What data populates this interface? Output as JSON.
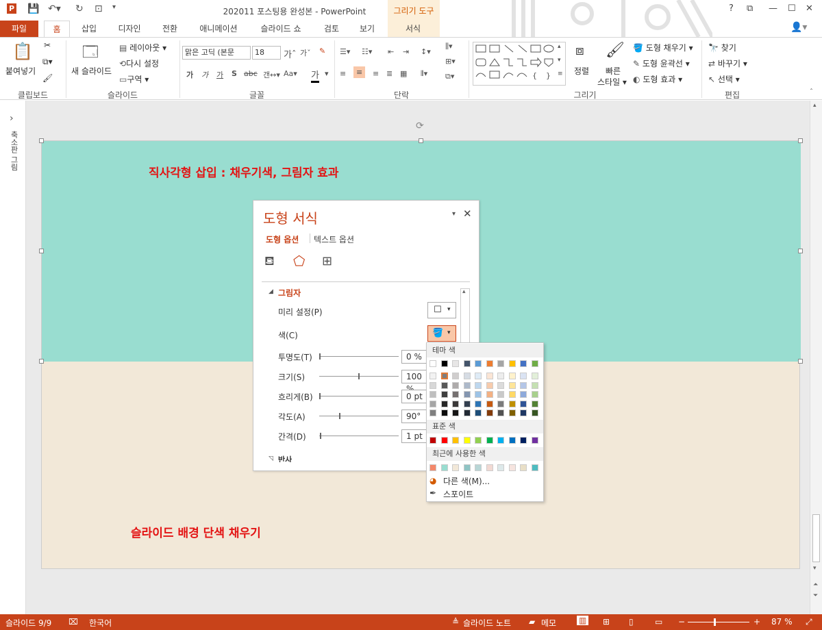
{
  "window": {
    "title": "202011 포스팅용 완성본 - PowerPoint",
    "context_tab_group": "그리기 도구",
    "help": "?",
    "minimize": "—",
    "maximize": "☐",
    "close": "✕"
  },
  "tabs": [
    "파일",
    "홈",
    "삽입",
    "디자인",
    "전환",
    "애니메이션",
    "슬라이드 쇼",
    "검토",
    "보기",
    "서식"
  ],
  "ribbon": {
    "clipboard": {
      "paste": "붙여넣기",
      "group": "클립보드"
    },
    "slides": {
      "new_slide": "새 슬라이드",
      "layout": "레이아웃 ▾",
      "reset": "다시 설정",
      "section": "구역 ▾",
      "group": "슬라이드"
    },
    "font": {
      "font_name": "맑은 고딕 (본문",
      "font_size": "18",
      "group": "글꼴"
    },
    "paragraph": {
      "group": "단락"
    },
    "drawing": {
      "arrange": "정렬",
      "quick_styles_1": "빠른",
      "quick_styles_2": "스타일 ▾",
      "shape_fill": "도형 채우기 ▾",
      "shape_outline": "도형 윤곽선 ▾",
      "shape_effects": "도형 효과 ▾",
      "group": "그리기"
    },
    "editing": {
      "find": "찾기",
      "replace": "바꾸기 ▾",
      "select": "선택 ▾",
      "group": "편집"
    }
  },
  "left_pane": {
    "label": "축소판 그림",
    "expand": "›"
  },
  "slide": {
    "rect_title": "직사각형 삽입 : 채우기색, 그림자 효과",
    "bg_title": "슬라이드 배경 단색 채우기",
    "rect_color": "#99ddd0",
    "bg_color": "#f2e8d8"
  },
  "format_pane": {
    "title": "도형 서식",
    "tab_shape": "도형 옵션",
    "tab_text": "텍스트 옵션",
    "section_shadow": "그림자",
    "section_next": "반사",
    "preset_label": "미리 설정(P)",
    "color_label": "색(C)",
    "props": [
      {
        "label": "투명도(T)",
        "value": "0 %",
        "level": 0.0
      },
      {
        "label": "크기(S)",
        "value": "100 %",
        "level": 0.5
      },
      {
        "label": "흐리게(B)",
        "value": "0 pt",
        "level": 0.0
      },
      {
        "label": "각도(A)",
        "value": "90°",
        "level": 0.25
      },
      {
        "label": "간격(D)",
        "value": "1 pt",
        "level": 0.01
      }
    ]
  },
  "color_picker": {
    "theme_header": "테마 색",
    "standard_header": "표준 색",
    "recent_header": "최근에 사용한 색",
    "more_colors": "다른 색(M)...",
    "eyedropper": "스포이트",
    "theme_top": [
      "#ffffff",
      "#000000",
      "#e7e6e6",
      "#44546a",
      "#5b9bd5",
      "#ed7d31",
      "#a5a5a5",
      "#ffc000",
      "#4472c4",
      "#70ad47"
    ],
    "theme_shades": [
      [
        "#f2f2f2",
        "#7f7f7f",
        "#d0cece",
        "#d6dce4",
        "#deebf6",
        "#fbe5d5",
        "#ededed",
        "#fff2cc",
        "#dae3f3",
        "#e2efd9"
      ],
      [
        "#d8d8d8",
        "#595959",
        "#aeabab",
        "#adb9ca",
        "#bdd7ee",
        "#f7cbac",
        "#dbdbdb",
        "#fee599",
        "#b4c6e7",
        "#c5e0b3"
      ],
      [
        "#bfbfbf",
        "#3f3f3f",
        "#757070",
        "#8496b0",
        "#9dc3e6",
        "#f4b183",
        "#c9c9c9",
        "#ffd965",
        "#8eaadb",
        "#a8d08d"
      ],
      [
        "#a5a5a5",
        "#262626",
        "#3a3838",
        "#333f4f",
        "#2e75b5",
        "#c55a11",
        "#7b7b7b",
        "#bf9000",
        "#2f5496",
        "#538135"
      ],
      [
        "#7f7f7f",
        "#0c0c0c",
        "#171616",
        "#222a35",
        "#1e4e79",
        "#833c0b",
        "#525252",
        "#7f6000",
        "#1f3864",
        "#375623"
      ]
    ],
    "standard": [
      "#c00000",
      "#ff0000",
      "#ffc000",
      "#ffff00",
      "#92d050",
      "#00b050",
      "#00b0f0",
      "#0070c0",
      "#002060",
      "#7030a0"
    ],
    "recent": [
      "#f4886a",
      "#99ddd0",
      "#f2e8d8",
      "#8fc4c4",
      "#b8d6d6",
      "#f2d9d3",
      "#dde9ea",
      "#f6e4df",
      "#e9dfc7",
      "#4fbcc0"
    ]
  },
  "status": {
    "slide_num": "슬라이드 9/9",
    "language": "한국어",
    "notes": "슬라이드 노트",
    "comments": "메모",
    "zoom": "87 %"
  }
}
